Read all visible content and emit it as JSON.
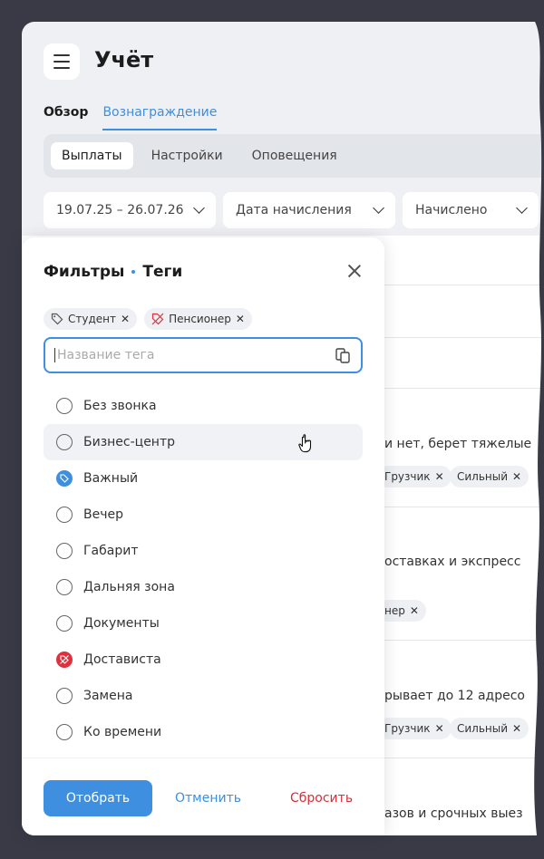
{
  "app": {
    "title": "Учёт",
    "menu_icon": "hamburger-menu-icon"
  },
  "tabs": [
    {
      "label": "Обзор"
    },
    {
      "label": "Вознаграждение"
    }
  ],
  "subtabs": [
    {
      "label": "Выплаты"
    },
    {
      "label": "Настройки"
    },
    {
      "label": "Оповещения"
    }
  ],
  "filter_row": {
    "date_range": "19.07.25 – 26.07.26",
    "date_type": "Дата начисления",
    "status": "Начислено"
  },
  "background_rows": [
    "и нет, берет тяжелые",
    "оставках и экспресс",
    "рывает до 12 адресо",
    "азов и срочных выез"
  ],
  "background_chips": {
    "mover": "Грузчик",
    "strong": "Сильный",
    "pensioner_tail": "нер"
  },
  "panel": {
    "title": "Фильтры",
    "subtitle": "Теги",
    "selected_tags": [
      {
        "label": "Студент",
        "icon": "tag-icon"
      },
      {
        "label": "Пенсионер",
        "icon": "tag-off-icon"
      }
    ],
    "search": {
      "placeholder": "Название тега",
      "value": ""
    },
    "options": [
      {
        "label": "Без звонка",
        "state": "empty"
      },
      {
        "label": "Бизнес-центр",
        "state": "empty"
      },
      {
        "label": "Важный",
        "state": "include"
      },
      {
        "label": "Вечер",
        "state": "empty"
      },
      {
        "label": "Габарит",
        "state": "empty"
      },
      {
        "label": "Дальняя зона",
        "state": "empty"
      },
      {
        "label": "Документы",
        "state": "empty"
      },
      {
        "label": "Достависта",
        "state": "exclude"
      },
      {
        "label": "Замена",
        "state": "empty"
      },
      {
        "label": "Ко времени",
        "state": "empty"
      }
    ],
    "apply_label": "Отобрать",
    "cancel_label": "Отменить",
    "reset_label": "Сбросить"
  },
  "colors": {
    "accent": "#3e8fe0",
    "danger": "#d72f3a",
    "backdrop": "#3a3a47"
  }
}
